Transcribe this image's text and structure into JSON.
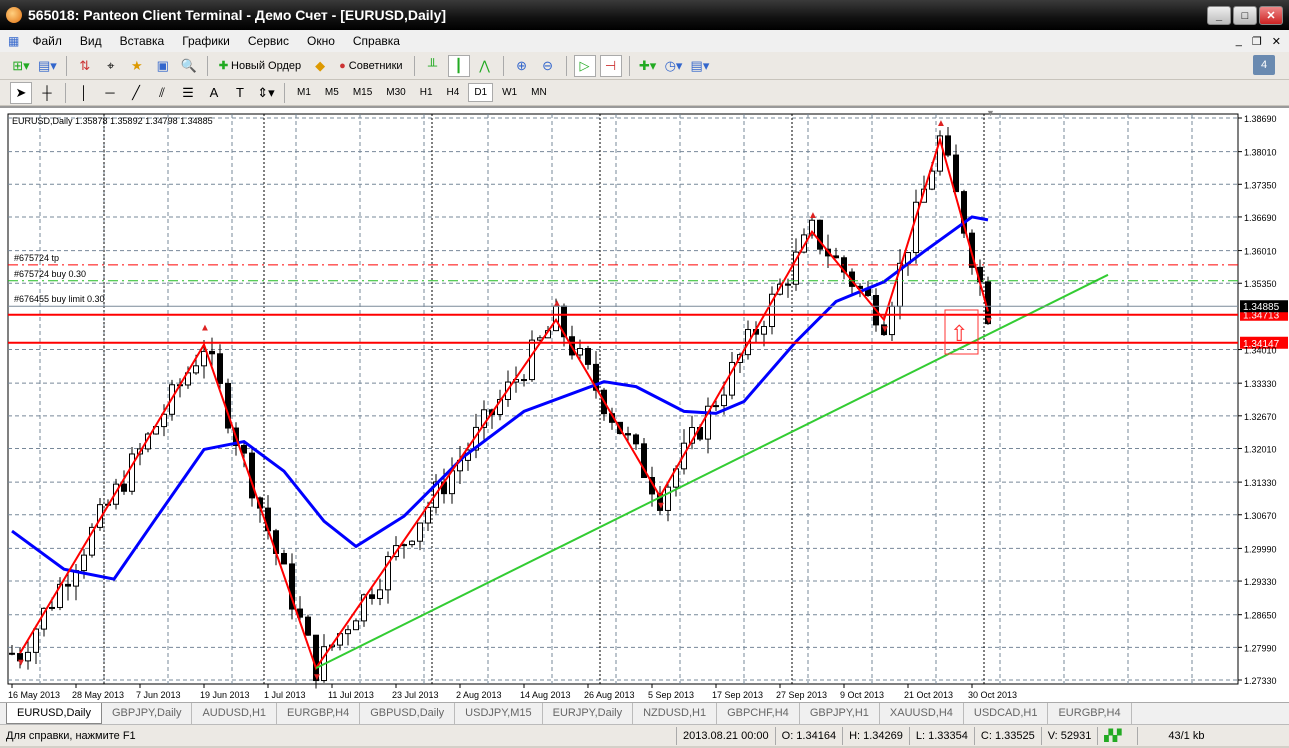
{
  "window": {
    "title": "565018: Panteon Client Terminal - Демо Счет - [EURUSD,Daily]",
    "min": "_",
    "max": "□",
    "close": "✕"
  },
  "menu": [
    "Файл",
    "Вид",
    "Вставка",
    "Графики",
    "Сервис",
    "Окно",
    "Справка"
  ],
  "mdi": {
    "min": "_",
    "restore": "❐",
    "close": "✕"
  },
  "toolbar": {
    "new_order": "Новый Ордер",
    "experts": "Советники",
    "messages": "4"
  },
  "timeframes": [
    "M1",
    "M5",
    "M15",
    "M30",
    "H1",
    "H4",
    "D1",
    "W1",
    "MN"
  ],
  "active_timeframe": "D1",
  "chart": {
    "header": "EURUSD,Daily  1.35878 1.35892 1.34798 1.34885",
    "price_ticks": [
      "1.38690",
      "1.38010",
      "1.37350",
      "1.36690",
      "1.36010",
      "1.35350",
      "1.34010",
      "1.33330",
      "1.32670",
      "1.32010",
      "1.31330",
      "1.30670",
      "1.29990",
      "1.29330",
      "1.28650",
      "1.27990",
      "1.27330"
    ],
    "price_tick_values": [
      1.3869,
      1.3801,
      1.3735,
      1.3669,
      1.3601,
      1.3535,
      1.3401,
      1.3333,
      1.3267,
      1.3201,
      1.3133,
      1.3067,
      1.2999,
      1.2933,
      1.2865,
      1.2799,
      1.2733
    ],
    "date_labels": [
      "16 May 2013",
      "28 May 2013",
      "7 Jun 2013",
      "19 Jun 2013",
      "1 Jul 2013",
      "11 Jul 2013",
      "23 Jul 2013",
      "2 Aug 2013",
      "14 Aug 2013",
      "26 Aug 2013",
      "5 Sep 2013",
      "17 Sep 2013",
      "27 Sep 2013",
      "9 Oct 2013",
      "21 Oct 2013",
      "30 Oct 2013"
    ],
    "date_label_bars": [
      0,
      8,
      16,
      24,
      32,
      40,
      48,
      56,
      64,
      72,
      80,
      88,
      96,
      104,
      112,
      120
    ],
    "ylim": [
      1.2733,
      1.3869
    ],
    "bars": 123,
    "current_price": "1.34885",
    "current_value": 1.34885,
    "levels": [
      {
        "label": "1.34713",
        "value": 1.34713,
        "color": "#ff0000"
      },
      {
        "label": "1.34147",
        "value": 1.34147,
        "color": "#ff0000"
      }
    ],
    "orders": [
      {
        "label": "#675724 tp",
        "value": 1.3572,
        "color": "#ff0000"
      },
      {
        "label": "#675724 buy 0.30",
        "value": 1.354,
        "color": "#22bb22"
      },
      {
        "label": "#676455 buy limit 0.30",
        "value": 1.34885,
        "color": "#7a8a99"
      }
    ],
    "zigzag": [
      [
        1,
        1.2787
      ],
      [
        24,
        1.3411
      ],
      [
        38,
        1.2757
      ],
      [
        68,
        1.3461
      ],
      [
        81,
        1.3104
      ],
      [
        100,
        1.3639
      ],
      [
        109,
        1.3461
      ],
      [
        116,
        1.3825
      ],
      [
        122,
        1.3478
      ]
    ],
    "trendline": [
      [
        38,
        1.2757
      ],
      [
        137,
        1.3552
      ]
    ],
    "moving_average": [
      [
        0,
        1.3034
      ],
      [
        6.5,
        1.2957
      ],
      [
        12.75,
        1.2937
      ],
      [
        17.75,
        1.3054
      ],
      [
        24,
        1.3199
      ],
      [
        29,
        1.3215
      ],
      [
        34,
        1.3155
      ],
      [
        39,
        1.3054
      ],
      [
        43,
        1.3003
      ],
      [
        49,
        1.3064
      ],
      [
        56.5,
        1.3185
      ],
      [
        64,
        1.3276
      ],
      [
        74,
        1.3336
      ],
      [
        78,
        1.3326
      ],
      [
        84,
        1.3276
      ],
      [
        88,
        1.3272
      ],
      [
        91.5,
        1.3296
      ],
      [
        98,
        1.3417
      ],
      [
        103,
        1.3498
      ],
      [
        109,
        1.3538
      ],
      [
        114,
        1.3599
      ],
      [
        120,
        1.3669
      ],
      [
        122,
        1.3663
      ]
    ],
    "colors": {
      "zigzag": "#ff0000",
      "ma": "#0000ff",
      "trend": "#33cc33",
      "grid": "#778899"
    }
  },
  "tabs": [
    "EURUSD,Daily",
    "GBPJPY,Daily",
    "AUDUSD,H1",
    "EURGBP,H4",
    "GBPUSD,Daily",
    "USDJPY,M15",
    "EURJPY,Daily",
    "NZDUSD,H1",
    "GBPCHF,H4",
    "GBPJPY,H1",
    "XAUUSD,H4",
    "USDCAD,H1",
    "EURGBP,H4"
  ],
  "status": {
    "help": "Для справки, нажмите F1",
    "datetime": "2013.08.21 00:00",
    "open": "O: 1.34164",
    "high": "H: 1.34269",
    "low": "L: 1.33354",
    "close": "C: 1.33525",
    "volume": "V: 52931",
    "traffic": "43/1 kb"
  }
}
